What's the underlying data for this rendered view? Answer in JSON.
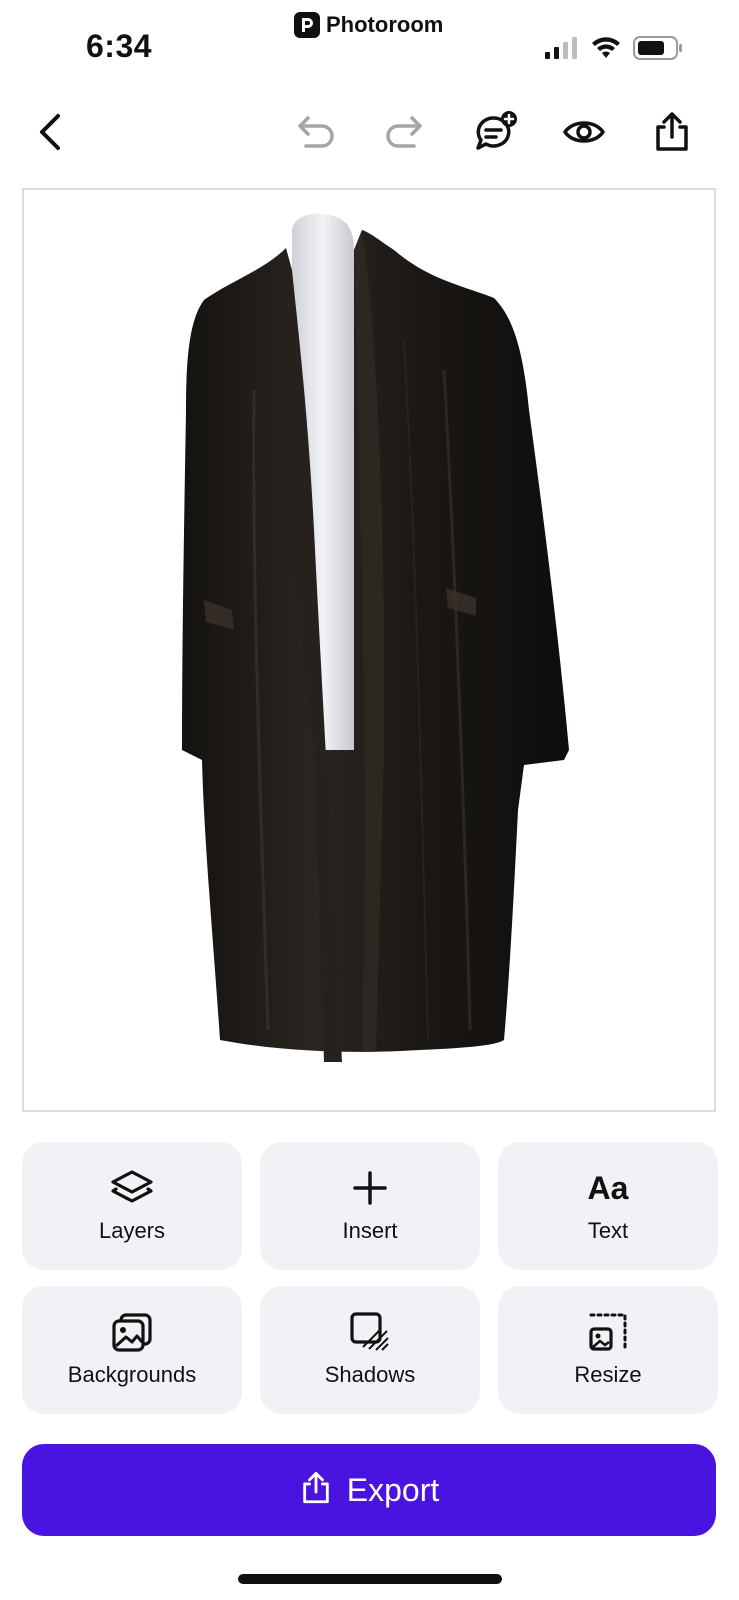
{
  "status_bar": {
    "time": "6:34",
    "app_name": "Photoroom",
    "icons": [
      "cellular-signal-icon",
      "wifi-icon",
      "battery-icon"
    ]
  },
  "toolbar": {
    "icons": [
      "back-chevron-icon",
      "undo-icon",
      "redo-icon",
      "add-comment-icon",
      "preview-eye-icon",
      "share-icon"
    ]
  },
  "canvas": {
    "subject": "black velvet long coat on mannequin"
  },
  "tools": [
    {
      "label": "Layers",
      "icon": "layers-icon"
    },
    {
      "label": "Insert",
      "icon": "plus-icon"
    },
    {
      "label": "Text",
      "icon": "text-aa-icon",
      "glyph": "Aa"
    },
    {
      "label": "Backgrounds",
      "icon": "backgrounds-icon"
    },
    {
      "label": "Shadows",
      "icon": "shadows-icon"
    },
    {
      "label": "Resize",
      "icon": "resize-icon"
    }
  ],
  "export": {
    "label": "Export",
    "icon": "share-icon"
  },
  "colors": {
    "accent": "#4a14e0",
    "tile_bg": "#f1f2f5",
    "text": "#111111"
  }
}
